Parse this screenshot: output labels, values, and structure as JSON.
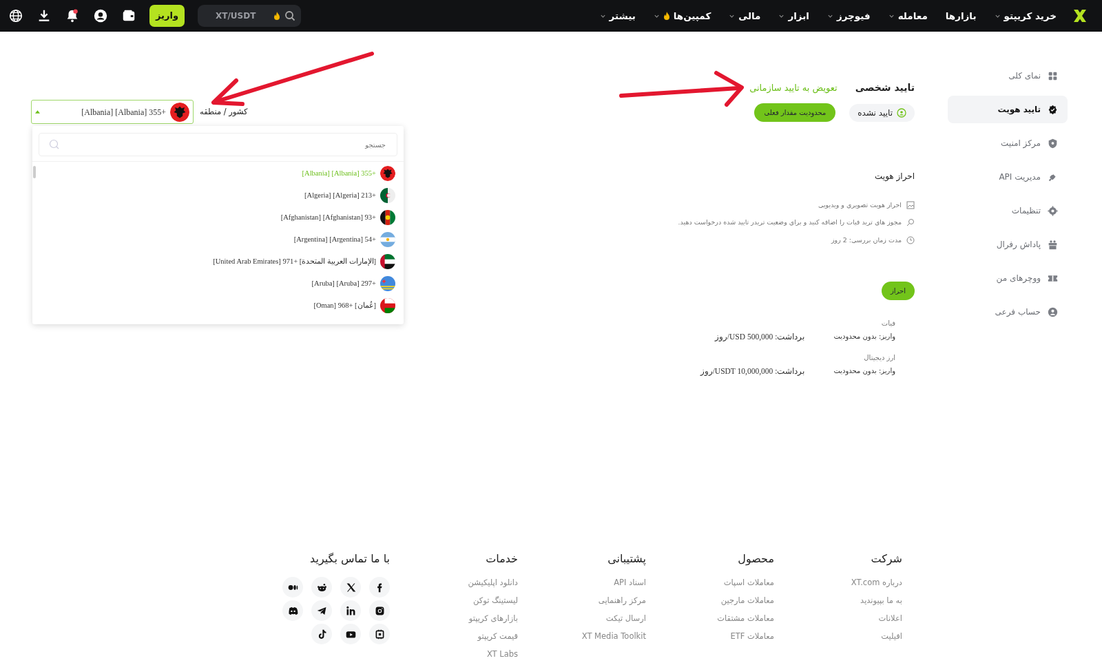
{
  "nav": {
    "menu": [
      {
        "label": "خرید کریپتو",
        "caret": true,
        "hot": false
      },
      {
        "label": "بازارها",
        "caret": false,
        "hot": false
      },
      {
        "label": "معامله",
        "caret": true,
        "hot": false
      },
      {
        "label": "فیوچرز",
        "caret": true,
        "hot": false
      },
      {
        "label": "ابزار",
        "caret": true,
        "hot": false
      },
      {
        "label": "مالی",
        "caret": true,
        "hot": false
      },
      {
        "label": "کمپین‌ها",
        "caret": true,
        "hot": true
      },
      {
        "label": "بیشتر",
        "caret": true,
        "hot": false
      }
    ],
    "search": {
      "placeholder": "XT/USDT"
    },
    "deposit_button": "واریز",
    "notifications": {
      "unread": true
    }
  },
  "sidebar": {
    "items": [
      {
        "label": "نمای کلی",
        "selected": false
      },
      {
        "label": "تایید هویت",
        "selected": true
      },
      {
        "label": "مرکز امنیت",
        "selected": false
      },
      {
        "label": "مدیریت API",
        "selected": false
      },
      {
        "label": "تنظیمات",
        "selected": false
      },
      {
        "label": "پاداش رفرال",
        "selected": false
      },
      {
        "label": "ووچرهای من",
        "selected": false
      },
      {
        "label": "حساب فرعی",
        "selected": false
      }
    ]
  },
  "verification": {
    "title": "تایید شخصی",
    "switch_link": "تعویض به تایید سازمانی",
    "status": "تایید نشده",
    "limit_button": "محدودیت مقدار فعلی",
    "section_title": "احراز هویت",
    "features": [
      "احراز هویت تصویری و ویدیویی",
      "مجوز های ترید فیات را اضافه کنید و برای وضعیت تریدر تایید شده درخواست دهید.",
      "مدت زمان بررسی: 2 روز"
    ],
    "verify_button": "احراز",
    "limits": [
      {
        "title": "فیات",
        "deposit": "واریز: بدون محدودیت",
        "withdraw": "برداشت: USD 500,000/روز"
      },
      {
        "title": "ارز دیجیتال",
        "deposit": "واریز: بدون محدودیت",
        "withdraw": "برداشت: USDT 10,000,000/روز"
      }
    ]
  },
  "country_select": {
    "label": "کشور / منطقه",
    "value": "[Albania] [Albania] 355+",
    "open": true,
    "search": {
      "placeholder": "جستجو"
    },
    "options": [
      {
        "label": "[Albania] [Albania] 355+",
        "kind": "albania",
        "selected": true
      },
      {
        "label": "[Algeria] [Algeria] 213+",
        "kind": "algeria",
        "selected": false
      },
      {
        "label": "[Afghanistan] [Afghanistan] 93+",
        "kind": "afghanistan",
        "selected": false
      },
      {
        "label": "[Argentina] [Argentina] 54+",
        "kind": "argentina",
        "selected": false
      },
      {
        "label": "[United Arab Emirates] 971+ [الإمارات العربية المتحدة]",
        "kind": "uae",
        "selected": false
      },
      {
        "label": "[Aruba] [Aruba] 297+",
        "kind": "aruba",
        "selected": false
      },
      {
        "label": "[Oman] 968+ [عُمان]",
        "kind": "oman",
        "selected": false
      }
    ]
  },
  "footer": {
    "columns": [
      {
        "title": "شرکت",
        "links": [
          "درباره XT.com",
          "به ما بپیوندید",
          "اعلانات",
          "افیلیت"
        ]
      },
      {
        "title": "محصول",
        "links": [
          "معاملات اسپات",
          "معاملات مارجین",
          "معاملات مشتقات",
          "معاملات ETF"
        ]
      },
      {
        "title": "پشتیبانی",
        "links": [
          "اسناد API",
          "مرکز راهنمایی",
          "ارسال تیکت",
          "XT Media Toolkit"
        ]
      },
      {
        "title": "خدمات",
        "links": [
          "دانلود اپلیکیشن",
          "لیستینگ توکن",
          "بازارهای کریپتو",
          "قیمت کریپتو",
          "XT Labs"
        ]
      }
    ],
    "contact": {
      "title": "با ما تماس بگیرید",
      "socials": [
        {
          "kind": "facebook"
        },
        {
          "kind": "x"
        },
        {
          "kind": "reddit"
        },
        {
          "kind": "medium"
        },
        {
          "kind": "instagram"
        },
        {
          "kind": "linkedin"
        },
        {
          "kind": "telegram"
        },
        {
          "kind": "discord"
        },
        {
          "kind": "coin"
        },
        {
          "kind": "youtube"
        },
        {
          "kind": "tiktok"
        }
      ]
    }
  }
}
